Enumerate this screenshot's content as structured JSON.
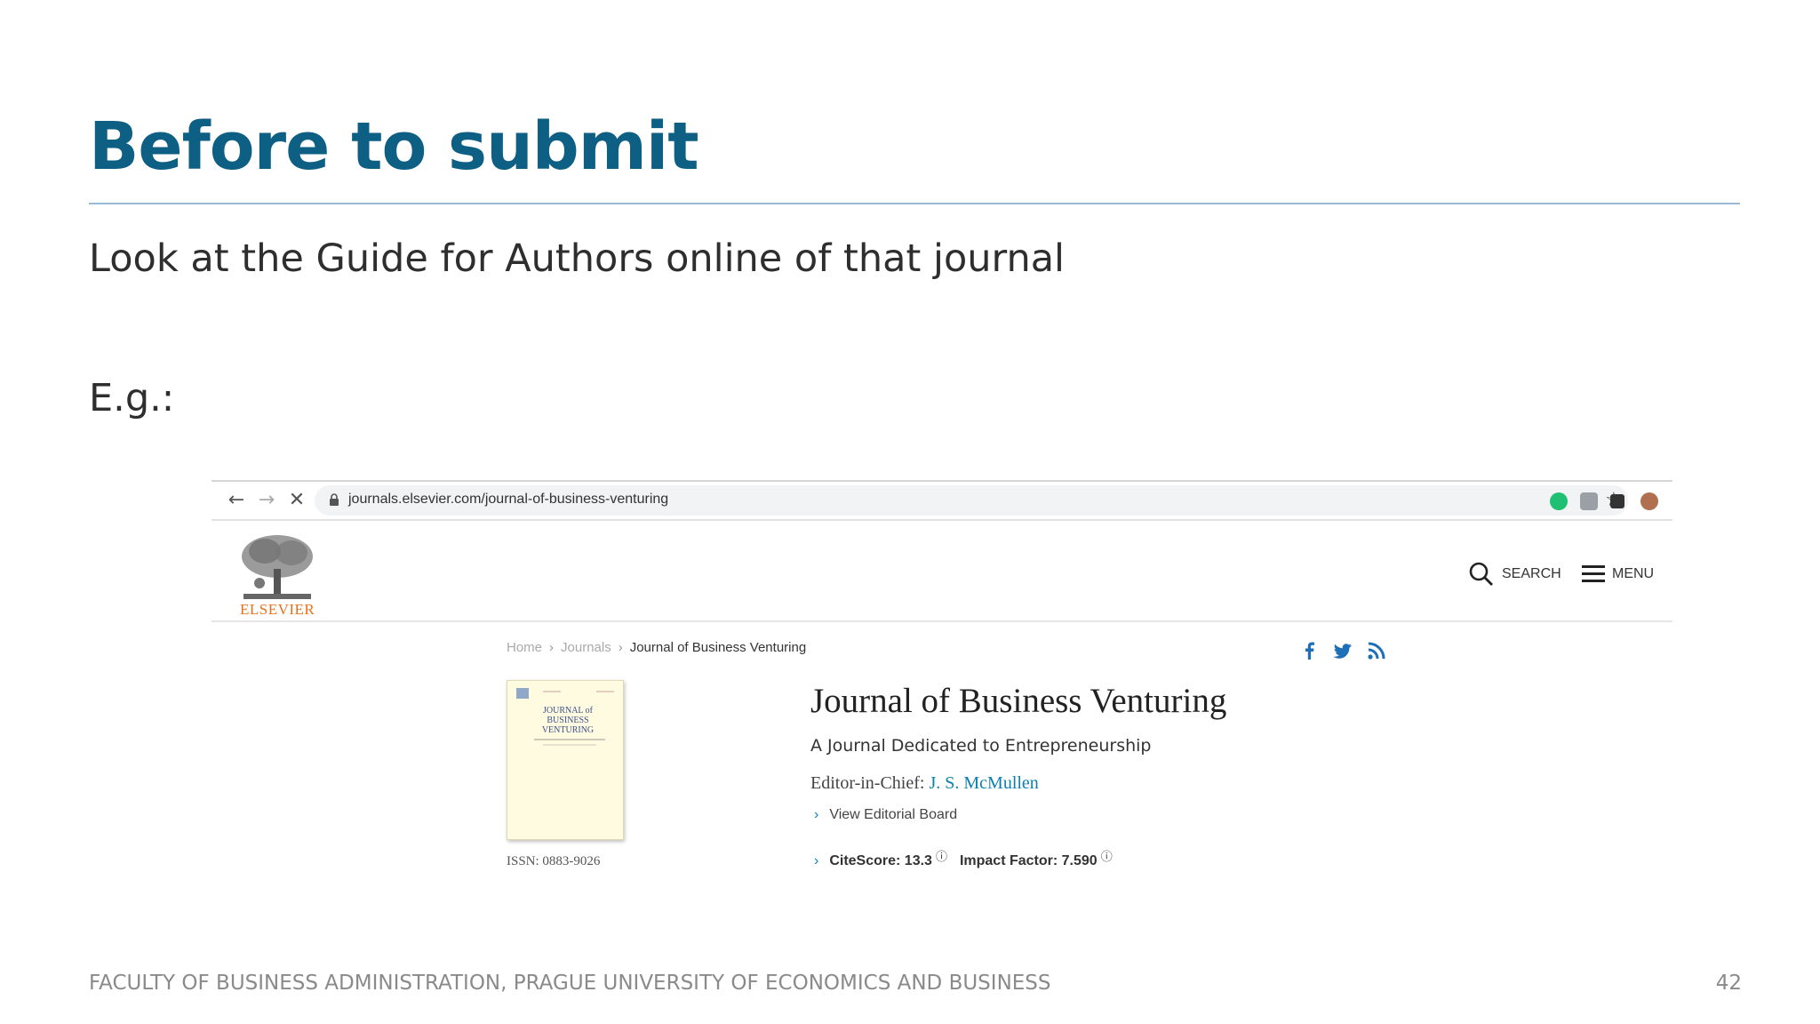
{
  "slide": {
    "title": "Before to submit",
    "subtitle": "Look at the Guide for Authors online of that journal",
    "example_label": "E.g.:",
    "footer": "FACULTY OF BUSINESS ADMINISTRATION, PRAGUE UNIVERSITY OF ECONOMICS AND BUSINESS",
    "page_number": "42"
  },
  "browser": {
    "url": "journals.elsevier.com/journal-of-business-venturing",
    "extension_colors": [
      "#1fbf74",
      "#9aa0a6",
      "#333333",
      "#b07050"
    ]
  },
  "site": {
    "logo_text": "ELSEVIER",
    "search_label": "SEARCH",
    "menu_label": "MENU",
    "breadcrumb": [
      "Home",
      "Journals",
      "Journal of Business Venturing"
    ],
    "journal_title": "Journal of Business Venturing",
    "journal_subtitle": "A Journal Dedicated to Entrepreneurship",
    "editor_label": "Editor-in-Chief:",
    "editor_name": "J. S. McMullen",
    "editorial_board_link": "View Editorial Board",
    "issn": "ISSN: 0883-9026",
    "citescore_label": "CiteScore: 13.3",
    "impact_factor_label": "Impact Factor: 7.590",
    "cover_text": "JOURNAL of BUSINESS VENTURING"
  },
  "colors": {
    "title": "#0e5f84",
    "elsevier_orange": "#e9711c",
    "link_blue": "#0c7fb0",
    "social_blue": "#1d6fb8"
  }
}
